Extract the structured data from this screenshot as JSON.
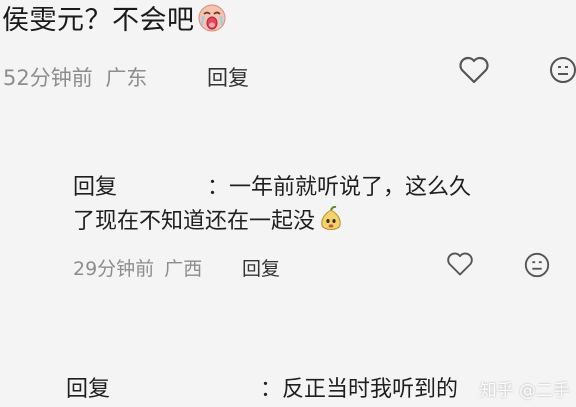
{
  "comment1": {
    "text": "侯雯元？不会吧",
    "emoji": "crying-face-emoji",
    "time": "52分钟前",
    "location": "广东",
    "reply_label": "回复"
  },
  "reply1": {
    "prefix": "回复",
    "separator": "：",
    "line1": "一年前就听说了，这么久",
    "line2": "了现在不知道还在一起没",
    "emoji": "pear-character-emoji",
    "time": "29分钟前",
    "location": "广西",
    "reply_label": "回复"
  },
  "reply2": {
    "prefix": "回复",
    "separator": "：",
    "text": "反正当时我听到的"
  },
  "watermark": "知乎 @二手",
  "icons": {
    "like": "heart-outline-icon",
    "comment": "smiley-outline-icon"
  },
  "colors": {
    "background": "#f4f4f4",
    "meta": "#8d8d8d",
    "text": "#1a1a1a"
  }
}
